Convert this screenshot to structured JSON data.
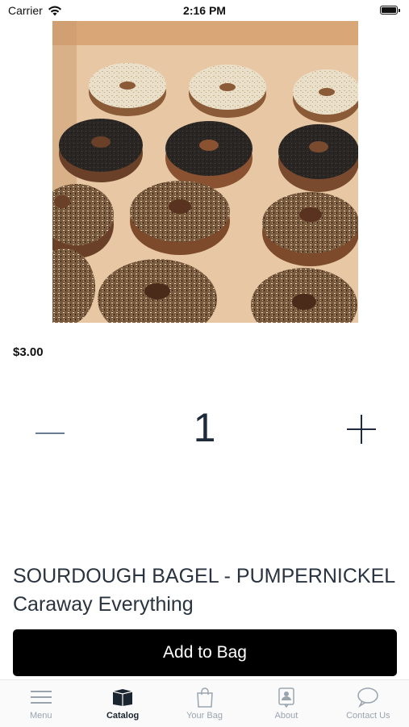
{
  "status_bar": {
    "carrier": "Carrier",
    "time": "2:16 PM"
  },
  "product": {
    "price": "$3.00",
    "quantity": "1",
    "title": "SOURDOUGH BAGEL - PUMPERNICKEL Caraway Everything",
    "add_button_label": "Add to Bag"
  },
  "tabs": [
    {
      "label": "Menu",
      "icon": "menu-icon",
      "active": false
    },
    {
      "label": "Catalog",
      "icon": "catalog-icon",
      "active": true
    },
    {
      "label": "Your Bag",
      "icon": "bag-icon",
      "active": false
    },
    {
      "label": "About",
      "icon": "about-icon",
      "active": false
    },
    {
      "label": "Contact Us",
      "icon": "chat-icon",
      "active": false
    }
  ],
  "colors": {
    "accent": "#000000",
    "tab_inactive": "#9aa4af",
    "tab_active": "#1b2530",
    "qty_text": "#1d2b3a"
  }
}
